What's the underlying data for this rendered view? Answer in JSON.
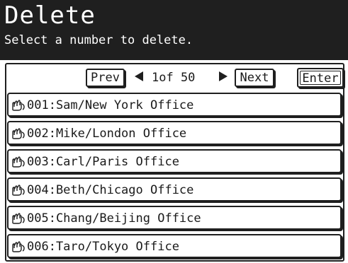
{
  "header": {
    "title": "Delete",
    "subtitle": "Select a number to delete."
  },
  "nav": {
    "prev_label": "Prev",
    "page_indicator": "1of 50",
    "next_label": "Next",
    "enter_label": "Enter"
  },
  "entries": [
    {
      "label": "001:Sam/New York Office",
      "icon": "phonebook-hand-icon"
    },
    {
      "label": "002:Mike/London Office",
      "icon": "phonebook-hand-icon"
    },
    {
      "label": "003:Carl/Paris Office",
      "icon": "phonebook-hand-icon"
    },
    {
      "label": "004:Beth/Chicago Office",
      "icon": "phonebook-hand-icon"
    },
    {
      "label": "005:Chang/Beijing Office",
      "icon": "phonebook-hand-icon"
    },
    {
      "label": "006:Taro/Tokyo Office",
      "icon": "phonebook-hand-icon"
    }
  ]
}
